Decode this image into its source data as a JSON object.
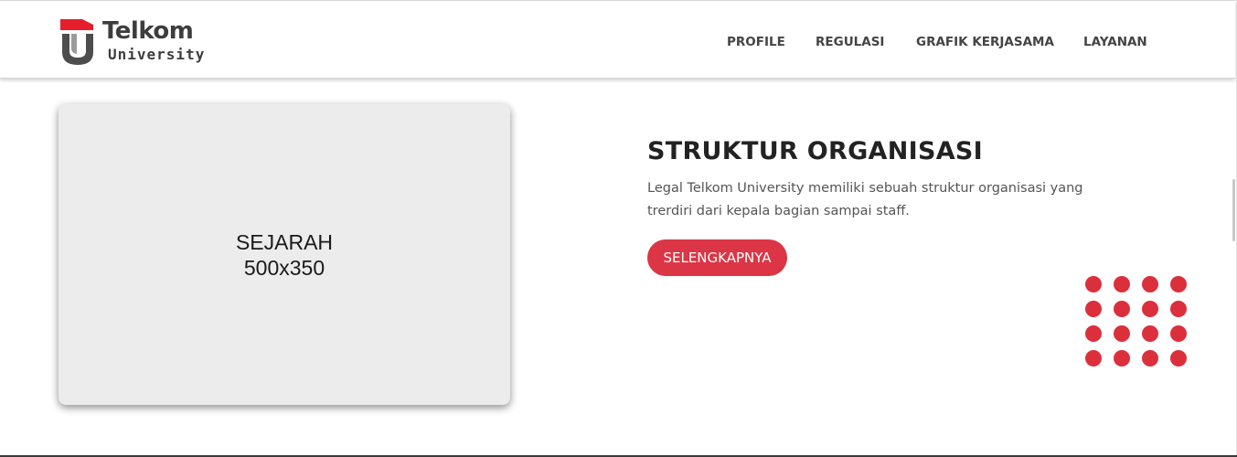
{
  "brand": {
    "title": "Telkom",
    "subtitle": "University",
    "logo_colors": [
      "#e41e2b",
      "#4d4d4d"
    ]
  },
  "nav": {
    "items": [
      {
        "label": "PROFILE"
      },
      {
        "label": "REGULASI"
      },
      {
        "label": "GRAFIK KERJASAMA"
      },
      {
        "label": "LAYANAN"
      }
    ]
  },
  "placeholder": {
    "line1": "SEJARAH",
    "line2": "500x350"
  },
  "section": {
    "title": "STRUKTUR ORGANISASI",
    "description_line1": "Legal Telkom University memiliki sebuah struktur organisasi yang",
    "description_line2": "trerdiri dari kepala bagian sampai staff.",
    "button_label": "SELENGKAPNYA"
  },
  "decor": {
    "dot_icon": "dot-grid-icon",
    "dot_color": "#dc2f3c"
  },
  "colors": {
    "accent": "#dc3545",
    "text_dark": "#222222",
    "text_muted": "#555555"
  }
}
